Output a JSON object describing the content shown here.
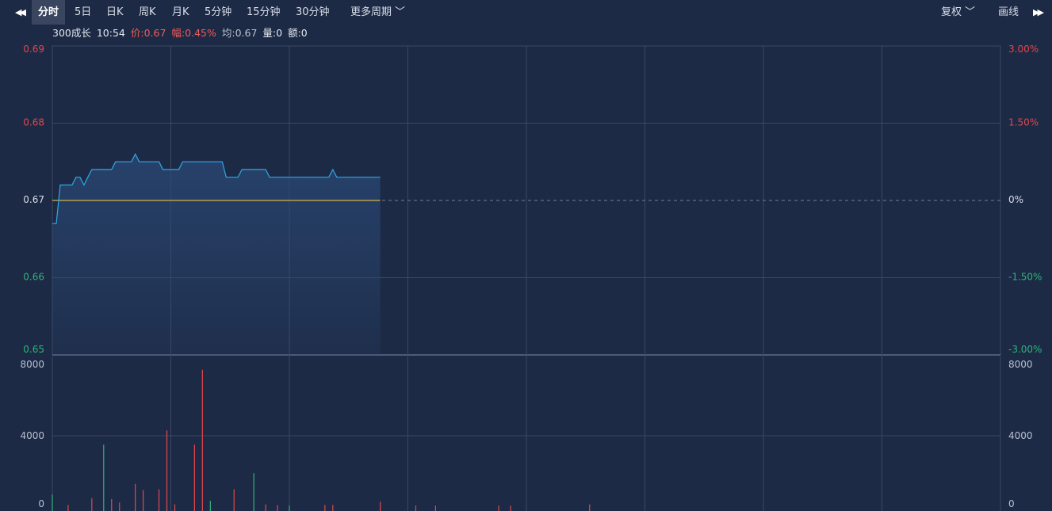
{
  "toolbar": {
    "prev_icon": "double-left-arrow-icon",
    "next_icon": "double-right-arrow-icon",
    "periods": [
      "分时",
      "5日",
      "日K",
      "周K",
      "月K",
      "5分钟",
      "15分钟",
      "30分钟"
    ],
    "active_period": "分时",
    "more_label": "更多周期",
    "fuquan_label": "复权",
    "draw_label": "画线"
  },
  "info": {
    "name": "300成长",
    "time": "10:54",
    "price": "价:0.67",
    "change": "幅:0.45%",
    "avg": "均:0.67",
    "volume": "量:0",
    "amount": "额:0"
  },
  "colors": {
    "background": "#1d2a45",
    "up": "#e0474c",
    "down": "#2cb57a",
    "price_line": "#2fa8e6",
    "avg_line": "#d8b24a",
    "grid": "#3a4865"
  },
  "chart_data": [
    {
      "type": "line",
      "y_left_ticks": [
        "0.69",
        "0.68",
        "0.67",
        "0.66",
        "0.65"
      ],
      "y_right_ticks": [
        "3.00%",
        "1.50%",
        "0%",
        "-1.50%",
        "-3.00%"
      ],
      "ylim": [
        0.65,
        0.69
      ],
      "baseline": 0.67,
      "x_points": 241,
      "series": [
        {
          "values": [
            0.667,
            0.667,
            0.672,
            0.672,
            0.672,
            0.672,
            0.673,
            0.673,
            0.672,
            0.673,
            0.674,
            0.674,
            0.674,
            0.674,
            0.674,
            0.674,
            0.675,
            0.675,
            0.675,
            0.675,
            0.675,
            0.676,
            0.675,
            0.675,
            0.675,
            0.675,
            0.675,
            0.675,
            0.674,
            0.674,
            0.674,
            0.674,
            0.674,
            0.675,
            0.675,
            0.675,
            0.675,
            0.675,
            0.675,
            0.675,
            0.675,
            0.675,
            0.675,
            0.675,
            0.673,
            0.673,
            0.673,
            0.673,
            0.674,
            0.674,
            0.674,
            0.674,
            0.674,
            0.674,
            0.674,
            0.673,
            0.673,
            0.673,
            0.673,
            0.673,
            0.673,
            0.673,
            0.673,
            0.673,
            0.673,
            0.673,
            0.673,
            0.673,
            0.673,
            0.673,
            0.673,
            0.674,
            0.673,
            0.673,
            0.673,
            0.673,
            0.673,
            0.673,
            0.673,
            0.673,
            0.673,
            0.673,
            0.673,
            0.673
          ]
        },
        {
          "values": [
            0.67
          ]
        }
      ]
    },
    {
      "type": "bar",
      "y_left_ticks": [
        "8000",
        "4000",
        "0"
      ],
      "y_right_ticks": [
        "8000",
        "4000",
        "0"
      ],
      "ylim": [
        0,
        8000
      ],
      "bars": [
        {
          "i": 0,
          "v": 700,
          "d": "down"
        },
        {
          "i": 4,
          "v": 120,
          "d": "up"
        },
        {
          "i": 10,
          "v": 500,
          "d": "up"
        },
        {
          "i": 13,
          "v": 3500,
          "d": "down"
        },
        {
          "i": 15,
          "v": 450,
          "d": "up"
        },
        {
          "i": 17,
          "v": 250,
          "d": "up"
        },
        {
          "i": 21,
          "v": 1300,
          "d": "up"
        },
        {
          "i": 23,
          "v": 950,
          "d": "up"
        },
        {
          "i": 27,
          "v": 1000,
          "d": "up"
        },
        {
          "i": 29,
          "v": 4300,
          "d": "up"
        },
        {
          "i": 31,
          "v": 150,
          "d": "up"
        },
        {
          "i": 36,
          "v": 3500,
          "d": "up"
        },
        {
          "i": 38,
          "v": 7700,
          "d": "up"
        },
        {
          "i": 40,
          "v": 350,
          "d": "down"
        },
        {
          "i": 46,
          "v": 1000,
          "d": "up"
        },
        {
          "i": 51,
          "v": 1900,
          "d": "down"
        },
        {
          "i": 54,
          "v": 150,
          "d": "up"
        },
        {
          "i": 57,
          "v": 100,
          "d": "up"
        },
        {
          "i": 60,
          "v": 80,
          "d": "down"
        },
        {
          "i": 69,
          "v": 120,
          "d": "up"
        },
        {
          "i": 71,
          "v": 120,
          "d": "up"
        },
        {
          "i": 83,
          "v": 300,
          "d": "up"
        },
        {
          "i": 92,
          "v": 80,
          "d": "up"
        },
        {
          "i": 97,
          "v": 80,
          "d": "up"
        },
        {
          "i": 113,
          "v": 80,
          "d": "up"
        },
        {
          "i": 116,
          "v": 80,
          "d": "up"
        },
        {
          "i": 136,
          "v": 150,
          "d": "up"
        }
      ]
    }
  ]
}
